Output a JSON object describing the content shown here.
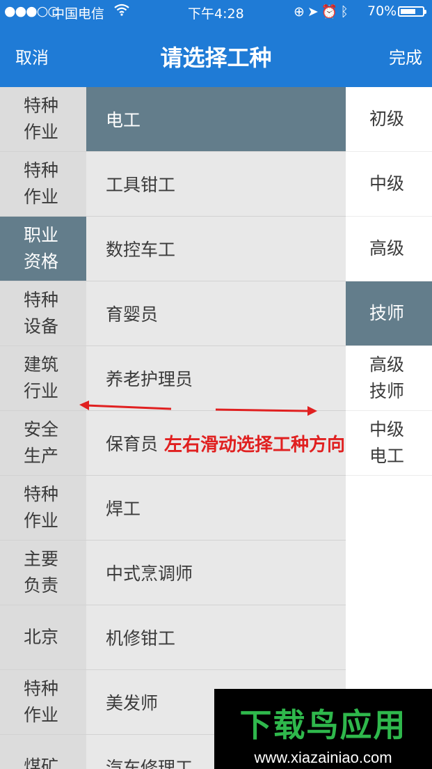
{
  "status_bar": {
    "signal": "●●●○○",
    "carrier": "中国电信",
    "wifi_icon": "wifi-icon",
    "time": "下午4:28",
    "battery": "70%"
  },
  "nav": {
    "cancel_label": "取消",
    "title": "请选择工种",
    "done_label": "完成",
    "background": "#1f7bd6"
  },
  "left_column": [
    {
      "label": "特种作业"
    },
    {
      "label": "特种作业"
    },
    {
      "label": "职业资格",
      "selected": true
    },
    {
      "label": "特种设备"
    },
    {
      "label": "建筑行业"
    },
    {
      "label": "安全生产"
    },
    {
      "label": "特种作业"
    },
    {
      "label": "主要负责"
    },
    {
      "label": "北京"
    },
    {
      "label": "特种作业"
    },
    {
      "label": "煤矿"
    }
  ],
  "middle_column": [
    {
      "label": "电工",
      "selected": true
    },
    {
      "label": "工具钳工"
    },
    {
      "label": "数控车工"
    },
    {
      "label": "育婴员"
    },
    {
      "label": "养老护理员"
    },
    {
      "label": "保育员"
    },
    {
      "label": "焊工"
    },
    {
      "label": "中式烹调师"
    },
    {
      "label": "机修钳工"
    },
    {
      "label": "美发师"
    },
    {
      "label": "汽车修理工"
    }
  ],
  "right_column": [
    {
      "label": "初级"
    },
    {
      "label": "中级"
    },
    {
      "label": "高级"
    },
    {
      "label": "技师",
      "selected": true
    },
    {
      "label": "高级技师"
    },
    {
      "label": "中级电工"
    }
  ],
  "annotation": {
    "text": "左右滑动选择工种方向",
    "color": "#e02020"
  },
  "watermark": {
    "logo": "下载鸟应用",
    "url": "www.xiazainiao.com"
  },
  "selected_color": "#637d8b"
}
